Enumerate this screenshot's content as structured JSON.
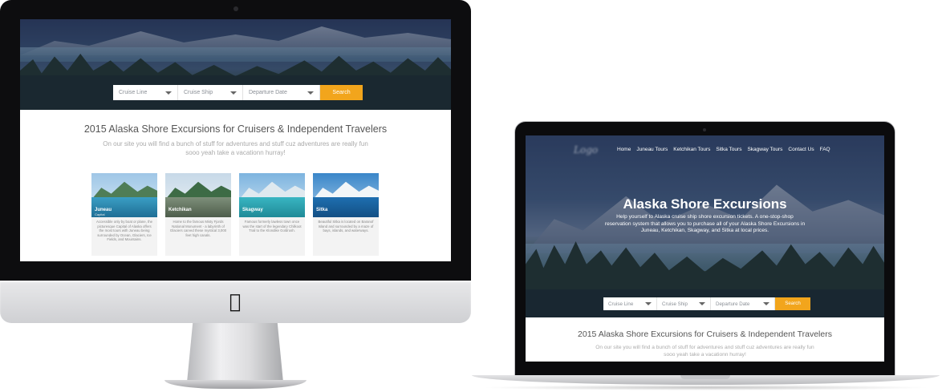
{
  "search": {
    "cruise_line": "Cruise Line",
    "cruise_ship": "Cruise Ship",
    "departure_date": "Departure Date",
    "button": "Search"
  },
  "section": {
    "title": "2015 Alaska Shore Excursions for Cruisers & Independent Travelers",
    "subtitle": "On our site you will find a bunch of stuff for adventures and stuff cuz adventures are really fun sooo yeah take a vacationn hurray!"
  },
  "cards": [
    {
      "label": "Juneau",
      "tag": "Capital",
      "text": "Accessible only by boat or plane, the picturesque Capital of Alaska offers the most tours with Juneau being surrounded by Ocean, Glaciers, Ice Fields, and Mountains."
    },
    {
      "label": "Ketchikan",
      "tag": "",
      "text": "Home to the famous Misty Fjords National Monument - a labyrinth of Glaciers carved these mystical 3,000 feet high canals."
    },
    {
      "label": "Skagway",
      "tag": "",
      "text": "Famous formerly lawless town once was the start of the legendary Chilkoot Trail to the Klondike Goldrush."
    },
    {
      "label": "Sitka",
      "tag": "",
      "text": "Beautiful Sitka is located on Baranof Island and surrounded by a maze of bays, islands, and waterways."
    }
  ],
  "laptop": {
    "logo": "Logo",
    "nav": [
      "Home",
      "Juneau Tours",
      "Ketchikan Tours",
      "Sitka Tours",
      "Skagway Tours",
      "Contact Us",
      "FAQ"
    ],
    "hero_title": "Alaska Shore Excursions",
    "hero_description": "Help yourself to Alaska cruise ship shore excursion tickets. A one-stop-shop reservation system that allows you to purchase all of your Alaska Shore Excursions in Juneau, Ketchikan, Skagway, and Sitka at local prices."
  },
  "colors": {
    "accent": "#f2a51c",
    "hero_overlay": "#1c2846"
  }
}
